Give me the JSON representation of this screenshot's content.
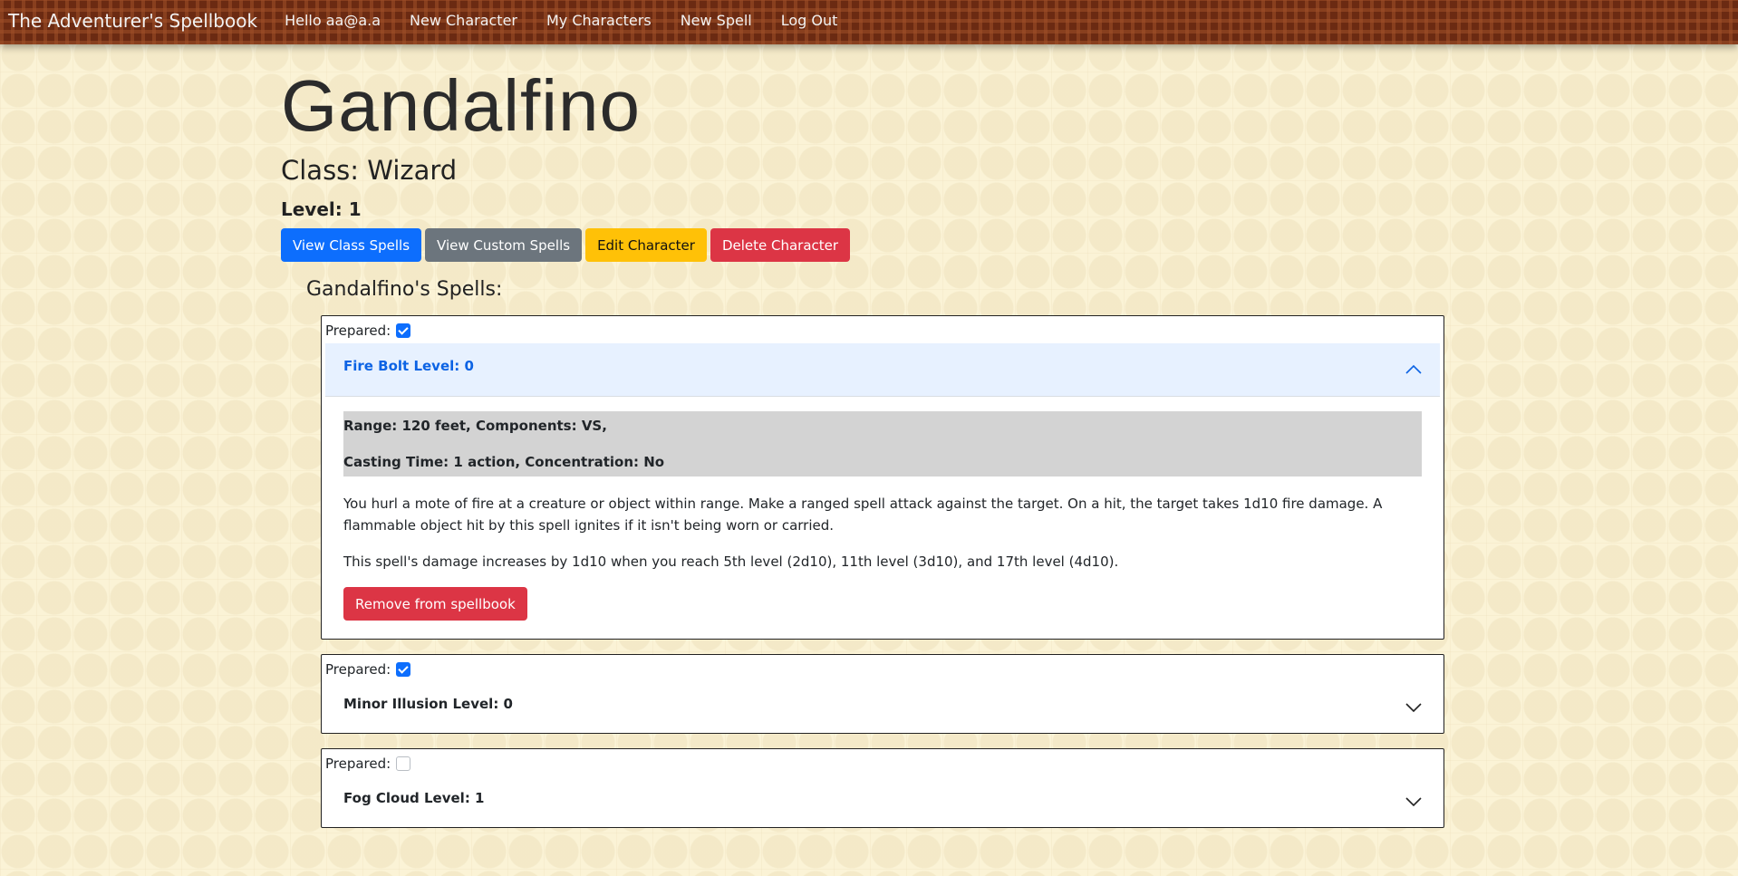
{
  "nav": {
    "brand": "The Adventurer's Spellbook",
    "links": [
      "Hello aa@a.a",
      "New Character",
      "My Characters",
      "New Spell",
      "Log Out"
    ]
  },
  "character": {
    "name": "Gandalfino",
    "class_label": "Class: Wizard",
    "level_label": "Level: 1"
  },
  "actions": {
    "view_class_spells": "View Class Spells",
    "view_custom_spells": "View Custom Spells",
    "edit_character": "Edit Character",
    "delete_character": "Delete Character"
  },
  "spells_heading": "Gandalfino's Spells:",
  "prepared_label": "Prepared:",
  "spells": [
    {
      "title": "Fire Bolt Level: 0",
      "prepared": true,
      "expanded": true,
      "range_components": "Range: 120 feet, Components: VS,",
      "casting_concentration": "Casting Time: 1 action, Concentration: No",
      "description": [
        "You hurl a mote of fire at a creature or object within range. Make a ranged spell attack against the target. On a hit, the target takes 1d10 fire damage. A flammable object hit by this spell ignites if it isn't being worn or carried.",
        "This spell's damage increases by 1d10 when you reach 5th level (2d10), 11th level (3d10), and 17th level (4d10)."
      ],
      "remove_label": "Remove from spellbook"
    },
    {
      "title": "Minor Illusion Level: 0",
      "prepared": true,
      "expanded": false
    },
    {
      "title": "Fog Cloud Level: 1",
      "prepared": false,
      "expanded": false
    }
  ],
  "colors": {
    "primary": "#0d6efd",
    "secondary": "#6c757d",
    "warning": "#ffc107",
    "danger": "#dc3545",
    "navbar": "#6b2a12",
    "accordion_open_bg": "#e7f1ff"
  }
}
